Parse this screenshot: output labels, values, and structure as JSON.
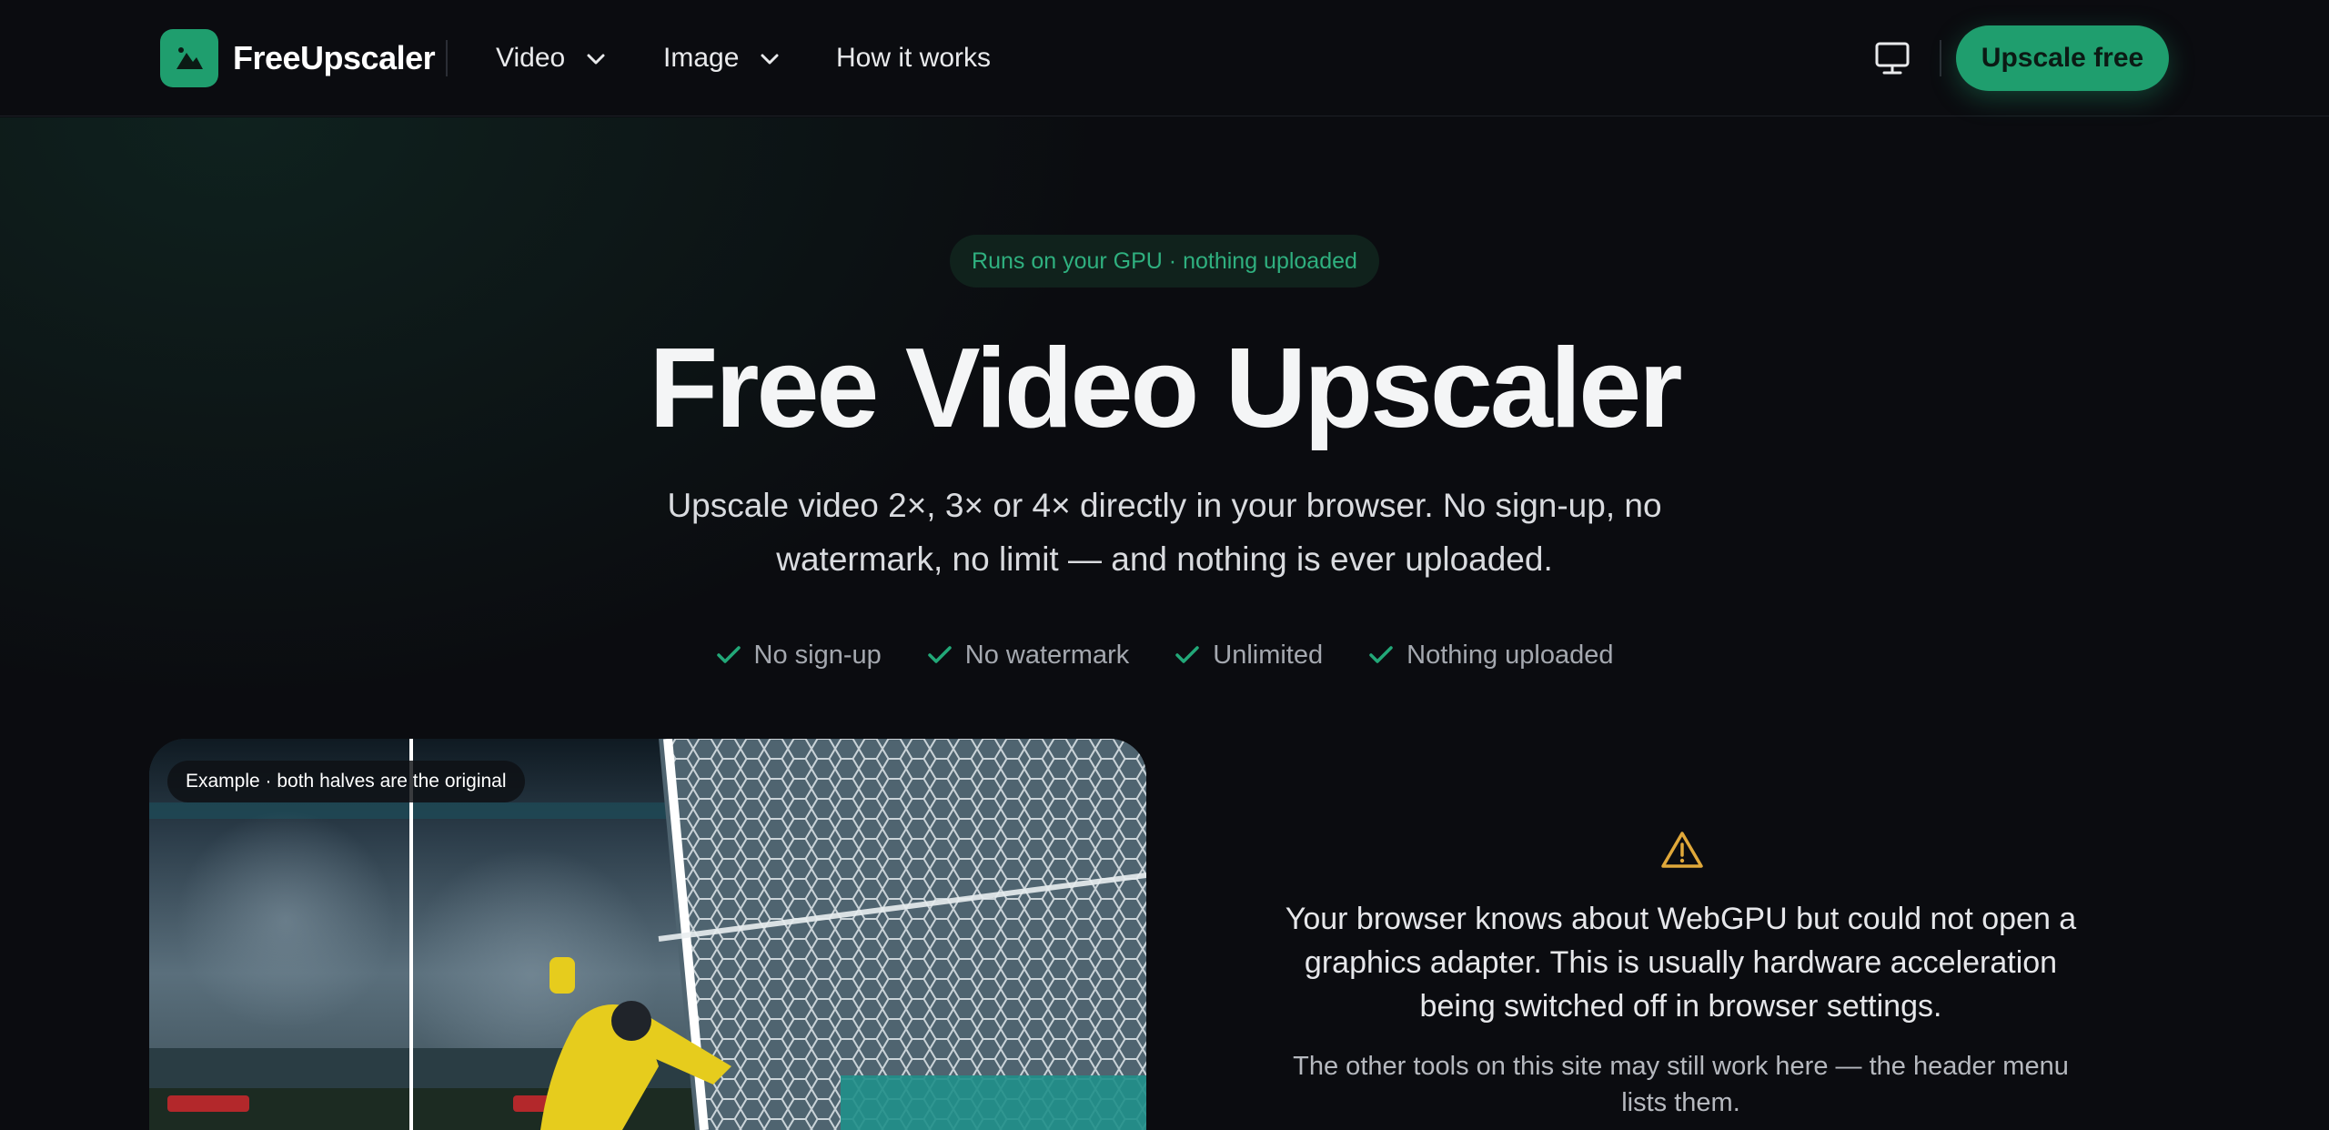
{
  "header": {
    "brand": "FreeUpscaler",
    "nav": {
      "video": "Video",
      "image": "Image",
      "how": "How it works"
    },
    "cta": "Upscale free"
  },
  "hero": {
    "badge": "Runs on your GPU · nothing uploaded",
    "title": "Free Video Upscaler",
    "subtitle": "Upscale video 2×, 3× or 4× directly in your browser. No sign-up, no watermark, no limit — and nothing is ever uploaded.",
    "features": [
      "No sign-up",
      "No watermark",
      "Unlimited",
      "Nothing uploaded"
    ]
  },
  "preview": {
    "label": "Example · both halves are the original"
  },
  "warning": {
    "message": "Your browser knows about WebGPU but could not open a graphics adapter. This is usually hardware acceleration being switched off in browser settings.",
    "note": "The other tools on this site may still work here — the header menu lists them."
  },
  "colors": {
    "accent": "#1f9e6e",
    "background": "#0b0c10",
    "warning": "#e0a83a"
  },
  "icons": [
    "logo-mountain-icon",
    "chevron-down-icon",
    "monitor-icon",
    "check-icon",
    "warning-triangle-icon"
  ]
}
